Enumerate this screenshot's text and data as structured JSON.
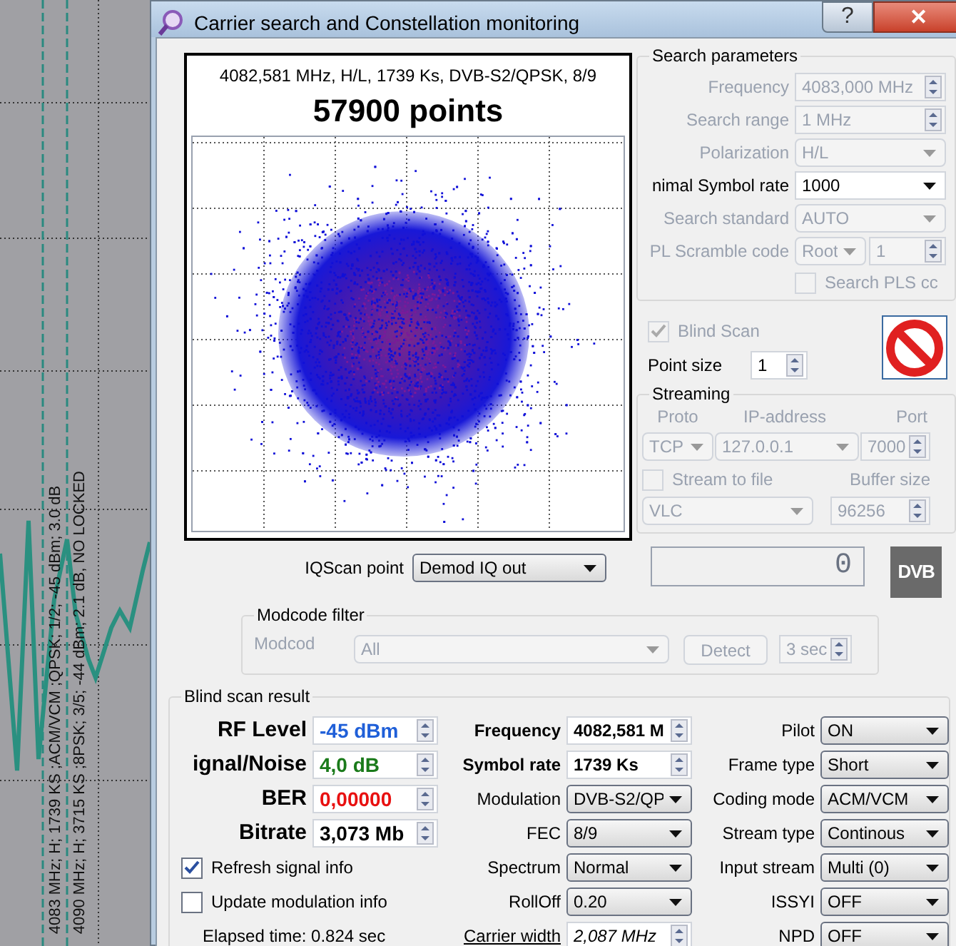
{
  "background_chart": {
    "labels": [
      "4083 MHz; H; 1739 KS ;ACM/VCM ;QPSK; 1/2; -45 dBm; 3.0 dB",
      "4090 MHz; H; 3715 KS ;8PSK; 3/5; -44 dBm; 2.1 dB, NO LOCKED"
    ]
  },
  "window": {
    "title": "Carrier search and Constellation monitoring",
    "help": "?",
    "close": "✕"
  },
  "constellation": {
    "info": "4082,581 MHz, H/L, 1739 Ks, DVB-S2/QPSK, 8/9",
    "points": "57900 points"
  },
  "search_parameters": {
    "title": "Search parameters",
    "fields": [
      {
        "label": "Frequency",
        "kind": "spin",
        "value": "4083,000 MHz",
        "disabled": true
      },
      {
        "label": "Search range",
        "kind": "spin",
        "value": "1 MHz",
        "disabled": true
      },
      {
        "label": "Polarization",
        "kind": "combo",
        "value": "H/L",
        "disabled": true
      },
      {
        "label": "nimal Symbol rate",
        "kind": "combo",
        "value": "1000",
        "disabled": false
      },
      {
        "label": "Search standard",
        "kind": "combo",
        "value": "AUTO",
        "disabled": true
      },
      {
        "label": "PL Scramble code",
        "kind": "combo_spin",
        "value": "Root",
        "value_2": "1",
        "disabled": true
      }
    ],
    "search_pls": {
      "label": "Search PLS cc",
      "checked": false,
      "disabled": true
    }
  },
  "blind_scan": {
    "label": "Blind Scan",
    "checked": true,
    "disabled": true
  },
  "point_size": {
    "label": "Point size",
    "value": "1"
  },
  "streaming": {
    "title": "Streaming",
    "headers": [
      "Proto",
      "IP-address",
      "Port"
    ],
    "proto": "TCP",
    "ip": "127.0.0.1",
    "port": "7000",
    "stream_to_file": {
      "label": "Stream to file",
      "checked": false,
      "disabled": true
    },
    "buffer_label": "Buffer size",
    "player": "VLC",
    "buffer": "96256",
    "disabled": true
  },
  "lcd": {
    "value": "0"
  },
  "logo": {
    "text": "DVB"
  },
  "iq_scan": {
    "label": "IQScan point",
    "value": "Demod IQ out"
  },
  "modcode_filter": {
    "title": "Modcode filter",
    "label": "Modcod",
    "value": "All",
    "detect": "Detect",
    "timeout": "3 sec",
    "disabled": true
  },
  "blind_scan_result": {
    "title": "Blind scan result",
    "signal": [
      {
        "label": "RF Level",
        "value": "-45 dBm",
        "color": "#1f5fd8"
      },
      {
        "label": "ignal/Noise",
        "value": "4,0 dB",
        "color": "#1a7a1a"
      },
      {
        "label": "BER",
        "value": "0,00000",
        "color": "#e81010"
      },
      {
        "label": "Bitrate",
        "value": "3,073 Mb",
        "color": "#000000"
      }
    ],
    "options": [
      {
        "kind": "checkbox",
        "label": "Refresh signal info",
        "checked": true
      },
      {
        "kind": "checkbox",
        "label": "Update modulation info",
        "checked": false
      },
      {
        "kind": "text",
        "label": "Elapsed time: 0.824 sec"
      }
    ],
    "modulation": [
      {
        "label": "Frequency",
        "bold": true,
        "link": false,
        "kind": "spin",
        "value": "4082,581 M"
      },
      {
        "label": "Symbol rate",
        "bold": true,
        "link": false,
        "kind": "spin",
        "value": "1739 Ks"
      },
      {
        "label": "Modulation",
        "bold": false,
        "link": false,
        "kind": "combo",
        "value": "DVB-S2/QP"
      },
      {
        "label": "FEC",
        "bold": false,
        "link": false,
        "kind": "combo",
        "value": "8/9"
      },
      {
        "label": "Spectrum",
        "bold": false,
        "link": false,
        "kind": "combo",
        "value": "Normal"
      },
      {
        "label": "RollOff",
        "bold": false,
        "link": false,
        "kind": "combo",
        "value": "0.20"
      },
      {
        "label": "Carrier width",
        "bold": false,
        "link": true,
        "kind": "spin",
        "value": "2,087 MHz"
      }
    ],
    "stream": [
      {
        "label": "Pilot",
        "value": "ON"
      },
      {
        "label": "Frame type",
        "value": "Short"
      },
      {
        "label": "Coding mode",
        "value": "ACM/VCM"
      },
      {
        "label": "Stream type",
        "value": "Continous"
      },
      {
        "label": "Input stream",
        "value": "Multi (0)"
      },
      {
        "label": "ISSYI",
        "value": "OFF"
      },
      {
        "label": "NPD",
        "value": "OFF"
      }
    ]
  }
}
